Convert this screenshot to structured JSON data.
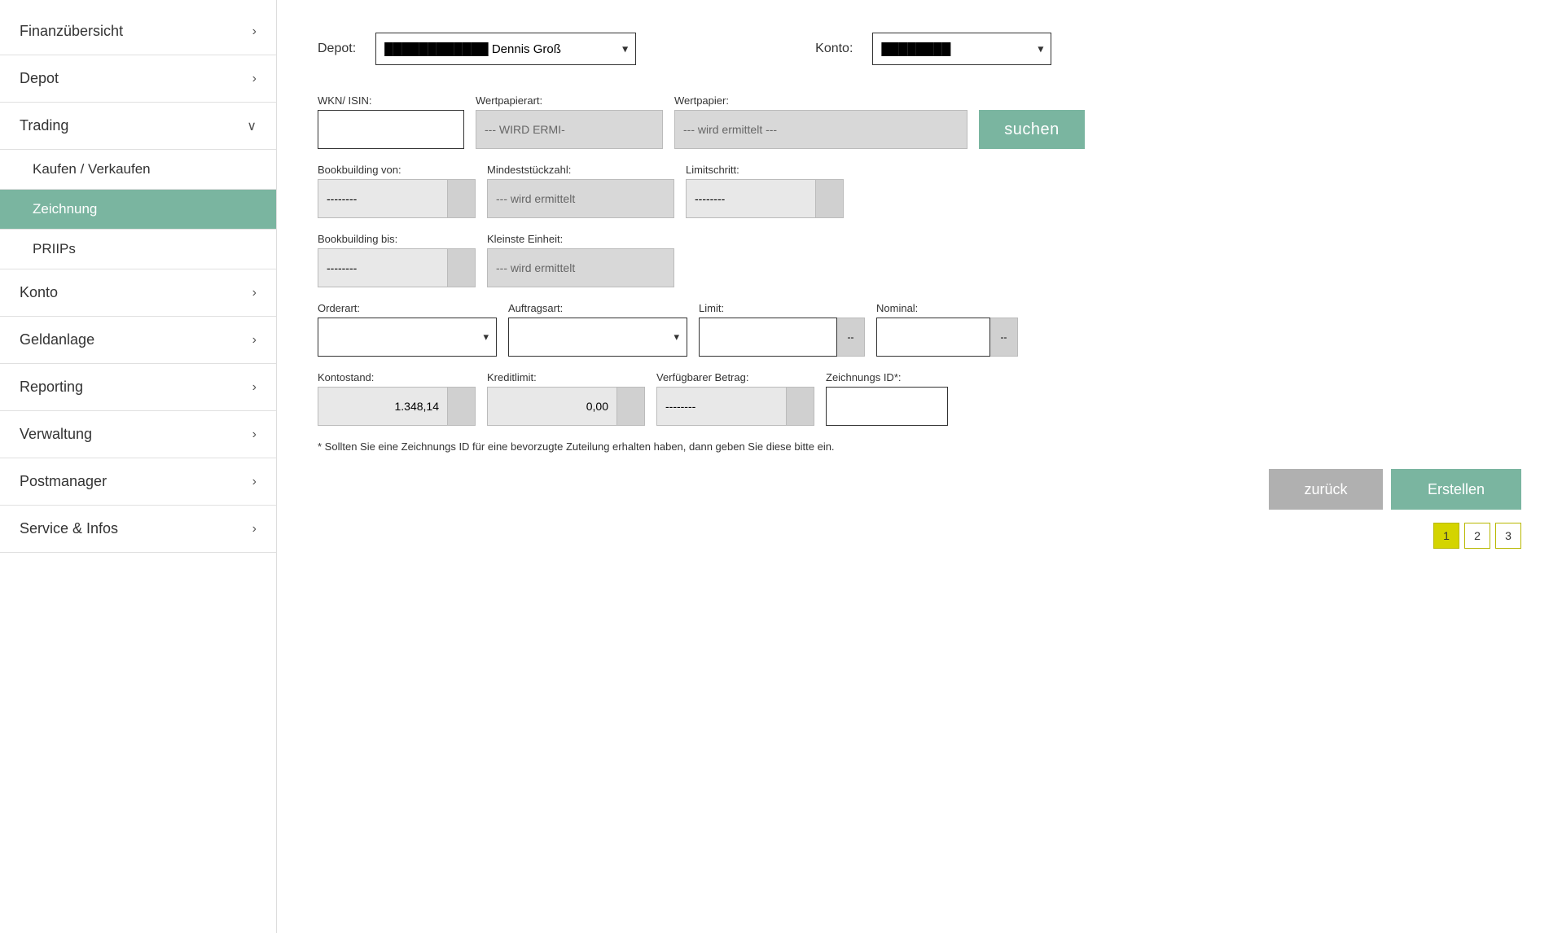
{
  "sidebar": {
    "items": [
      {
        "id": "finanzuebersicht",
        "label": "Finanzübersicht",
        "chevron": "›",
        "expanded": false,
        "active": false,
        "level": 0
      },
      {
        "id": "depot",
        "label": "Depot",
        "chevron": "›",
        "expanded": false,
        "active": false,
        "level": 0
      },
      {
        "id": "trading",
        "label": "Trading",
        "chevron": "∨",
        "expanded": true,
        "active": false,
        "level": 0
      },
      {
        "id": "kaufen-verkaufen",
        "label": "Kaufen / Verkaufen",
        "chevron": "",
        "expanded": false,
        "active": false,
        "level": 1
      },
      {
        "id": "zeichnung",
        "label": "Zeichnung",
        "chevron": "",
        "expanded": false,
        "active": true,
        "level": 1
      },
      {
        "id": "priips",
        "label": "PRIIPs",
        "chevron": "",
        "expanded": false,
        "active": false,
        "level": 1
      },
      {
        "id": "konto",
        "label": "Konto",
        "chevron": "›",
        "expanded": false,
        "active": false,
        "level": 0
      },
      {
        "id": "geldanlage",
        "label": "Geldanlage",
        "chevron": "›",
        "expanded": false,
        "active": false,
        "level": 0
      },
      {
        "id": "reporting",
        "label": "Reporting",
        "chevron": "›",
        "expanded": false,
        "active": false,
        "level": 0
      },
      {
        "id": "verwaltung",
        "label": "Verwaltung",
        "chevron": "›",
        "expanded": false,
        "active": false,
        "level": 0
      },
      {
        "id": "postmanager",
        "label": "Postmanager",
        "chevron": "›",
        "expanded": false,
        "active": false,
        "level": 0
      },
      {
        "id": "service-infos",
        "label": "Service & Infos",
        "chevron": "›",
        "expanded": false,
        "active": false,
        "level": 0
      }
    ]
  },
  "depot_label": "Depot:",
  "konto_label": "Konto:",
  "depot_value": "Dennis Groß",
  "form": {
    "wkn_label": "WKN/ ISIN:",
    "wkn_placeholder": "",
    "wertpapierart_label": "Wertpapierart:",
    "wertpapierart_value": "--- WIRD ERMI-",
    "wertpapier_label": "Wertpapier:",
    "wertpapier_value": "--- wird ermittelt ---",
    "suchen_label": "suchen",
    "bookbuilding_von_label": "Bookbuilding von:",
    "bookbuilding_von_value": "--------",
    "mindeststueckzahl_label": "Mindeststückzahl:",
    "mindeststueckzahl_value": "--- wird ermittelt",
    "limitschritt_label": "Limitschritt:",
    "limitschritt_value": "--------",
    "bookbuilding_bis_label": "Bookbuilding bis:",
    "bookbuilding_bis_value": "--------",
    "kleinste_einheit_label": "Kleinste Einheit:",
    "kleinste_einheit_value": "--- wird ermittelt",
    "orderart_label": "Orderart:",
    "auftragsart_label": "Auftragsart:",
    "limit_label": "Limit:",
    "nominal_label": "Nominal:",
    "kontostand_label": "Kontostand:",
    "kontostand_value": "1.348,14",
    "kreditlimit_label": "Kreditlimit:",
    "kreditlimit_value": "0,00",
    "verfuegbar_betrag_label": "Verfügbarer Betrag:",
    "verfuegbar_betrag_value": "--------",
    "zeichnungsid_label": "Zeichnungs ID*:",
    "footer_note": "* Sollten Sie eine Zeichnungs ID für eine bevorzugte Zuteilung erhalten haben, dann geben Sie diese bitte ein.",
    "zurueck_label": "zurück",
    "erstellen_label": "Erstellen"
  },
  "pagination": {
    "pages": [
      "1",
      "2",
      "3"
    ],
    "active_page": "1"
  }
}
